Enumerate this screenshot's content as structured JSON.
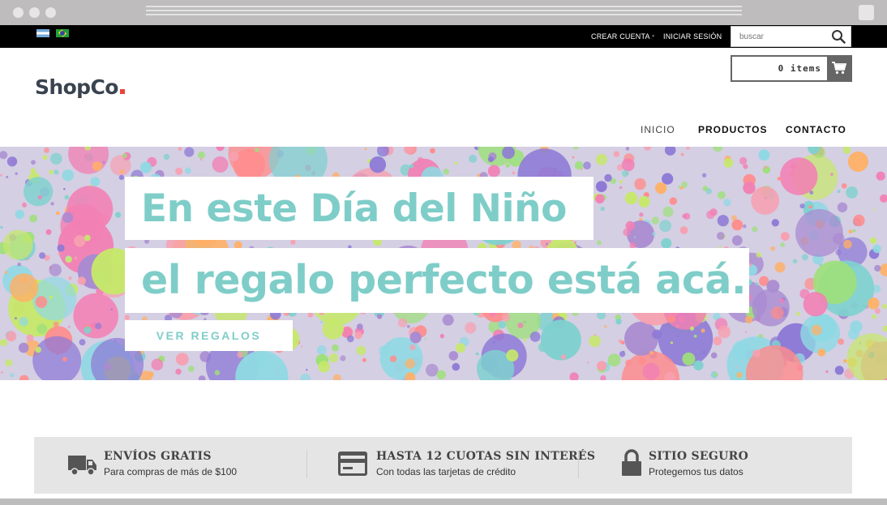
{
  "topbar": {
    "create_account": "CREAR CUENTA",
    "separator": "-",
    "login": "INICIAR SESIÓN",
    "search_placeholder": "buscar"
  },
  "header": {
    "logo": "ShopCo",
    "cart_label": "0 items"
  },
  "nav": [
    {
      "label": "INICIO"
    },
    {
      "label": "PRODUCTOS"
    },
    {
      "label": "CONTACTO"
    }
  ],
  "hero": {
    "line1": "En este Día del Niño",
    "line2": "el regalo perfecto está acá.",
    "button": "VER REGALOS"
  },
  "features": [
    {
      "icon": "truck-icon",
      "title": "ENVÍOS GRATIS",
      "subtitle": "Para compras de más de $100"
    },
    {
      "icon": "credit-card-icon",
      "title": "HASTA 12 CUOTAS SIN INTERÉS",
      "subtitle": "Con todas las tarjetas de crédito"
    },
    {
      "icon": "lock-icon",
      "title": "SITIO SEGURO",
      "subtitle": "Protegemos tus datos"
    }
  ],
  "colors": {
    "accent": "#7fcdc8",
    "logo_dot": "#e8453c",
    "topbar": "#000000"
  }
}
